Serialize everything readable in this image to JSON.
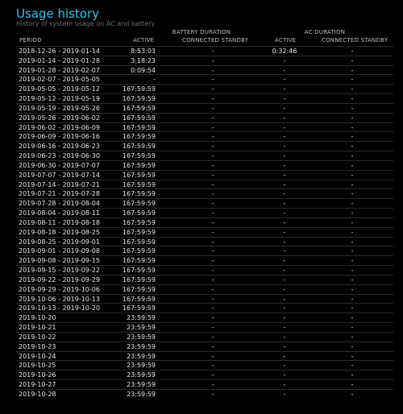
{
  "title": "Usage history",
  "subtitle": "History of system usage on AC and battery",
  "groups": {
    "battery": "BATTERY DURATION",
    "ac": "AC DURATION"
  },
  "columns": {
    "period": "PERIOD",
    "battery_active": "ACTIVE",
    "battery_standby": "CONNECTED STANDBY",
    "ac_active": "ACTIVE",
    "ac_standby": "CONNECTED STANDBY"
  },
  "rows": [
    {
      "period": "2018-12-26 - 2019-01-14",
      "battery_active": "8:53:03",
      "battery_standby": "-",
      "ac_active": "0:32:46",
      "ac_standby": "-"
    },
    {
      "period": "2019-01-14 - 2019-01-28",
      "battery_active": "3:18:23",
      "battery_standby": "-",
      "ac_active": "-",
      "ac_standby": "-"
    },
    {
      "period": "2019-01-28 - 2019-02-07",
      "battery_active": "0:09:54",
      "battery_standby": "-",
      "ac_active": "-",
      "ac_standby": "-"
    },
    {
      "period": "2019-02-07 - 2019-05-05",
      "battery_active": "-",
      "battery_standby": "-",
      "ac_active": "-",
      "ac_standby": "-"
    },
    {
      "period": "2019-05-05 - 2019-05-12",
      "battery_active": "167:59:59",
      "battery_standby": "-",
      "ac_active": "-",
      "ac_standby": "-"
    },
    {
      "period": "2019-05-12 - 2019-05-19",
      "battery_active": "167:59:59",
      "battery_standby": "-",
      "ac_active": "-",
      "ac_standby": "-"
    },
    {
      "period": "2019-05-19 - 2019-05-26",
      "battery_active": "167:59:59",
      "battery_standby": "-",
      "ac_active": "-",
      "ac_standby": "-"
    },
    {
      "period": "2019-05-26 - 2019-06-02",
      "battery_active": "167:59:59",
      "battery_standby": "-",
      "ac_active": "-",
      "ac_standby": "-"
    },
    {
      "period": "2019-06-02 - 2019-06-09",
      "battery_active": "167:59:59",
      "battery_standby": "-",
      "ac_active": "-",
      "ac_standby": "-"
    },
    {
      "period": "2019-06-09 - 2019-06-16",
      "battery_active": "167:59:59",
      "battery_standby": "-",
      "ac_active": "-",
      "ac_standby": "-"
    },
    {
      "period": "2019-06-16 - 2019-06-23",
      "battery_active": "167:59:59",
      "battery_standby": "-",
      "ac_active": "-",
      "ac_standby": "-"
    },
    {
      "period": "2019-06-23 - 2019-06-30",
      "battery_active": "167:59:59",
      "battery_standby": "-",
      "ac_active": "-",
      "ac_standby": "-"
    },
    {
      "period": "2019-06-30 - 2019-07-07",
      "battery_active": "167:59:59",
      "battery_standby": "-",
      "ac_active": "-",
      "ac_standby": "-"
    },
    {
      "period": "2019-07-07 - 2019-07-14",
      "battery_active": "167:59:59",
      "battery_standby": "-",
      "ac_active": "-",
      "ac_standby": "-"
    },
    {
      "period": "2019-07-14 - 2019-07-21",
      "battery_active": "167:59:59",
      "battery_standby": "-",
      "ac_active": "-",
      "ac_standby": "-"
    },
    {
      "period": "2019-07-21 - 2019-07-28",
      "battery_active": "167:59:59",
      "battery_standby": "-",
      "ac_active": "-",
      "ac_standby": "-"
    },
    {
      "period": "2019-07-28 - 2019-08-04",
      "battery_active": "167:59:59",
      "battery_standby": "-",
      "ac_active": "-",
      "ac_standby": "-"
    },
    {
      "period": "2019-08-04 - 2019-08-11",
      "battery_active": "167:59:59",
      "battery_standby": "-",
      "ac_active": "-",
      "ac_standby": "-"
    },
    {
      "period": "2019-08-11 - 2019-08-18",
      "battery_active": "167:59:59",
      "battery_standby": "-",
      "ac_active": "-",
      "ac_standby": "-"
    },
    {
      "period": "2019-08-18 - 2019-08-25",
      "battery_active": "167:59:59",
      "battery_standby": "-",
      "ac_active": "-",
      "ac_standby": "-"
    },
    {
      "period": "2019-08-25 - 2019-09-01",
      "battery_active": "167:59:59",
      "battery_standby": "-",
      "ac_active": "-",
      "ac_standby": "-"
    },
    {
      "period": "2019-09-01 - 2019-09-08",
      "battery_active": "167:59:59",
      "battery_standby": "-",
      "ac_active": "-",
      "ac_standby": "-"
    },
    {
      "period": "2019-09-08 - 2019-09-15",
      "battery_active": "167:59:59",
      "battery_standby": "-",
      "ac_active": "-",
      "ac_standby": "-"
    },
    {
      "period": "2019-09-15 - 2019-09-22",
      "battery_active": "167:59:59",
      "battery_standby": "-",
      "ac_active": "-",
      "ac_standby": "-"
    },
    {
      "period": "2019-09-22 - 2019-09-29",
      "battery_active": "167:59:59",
      "battery_standby": "-",
      "ac_active": "-",
      "ac_standby": "-"
    },
    {
      "period": "2019-09-29 - 2019-10-06",
      "battery_active": "167:59:59",
      "battery_standby": "-",
      "ac_active": "-",
      "ac_standby": "-"
    },
    {
      "period": "2019-10-06 - 2019-10-13",
      "battery_active": "167:59:59",
      "battery_standby": "-",
      "ac_active": "-",
      "ac_standby": "-"
    },
    {
      "period": "2019-10-13 - 2019-10-20",
      "battery_active": "167:59:59",
      "battery_standby": "-",
      "ac_active": "-",
      "ac_standby": "-"
    },
    {
      "period": "2019-10-20",
      "battery_active": "23:59:59",
      "battery_standby": "-",
      "ac_active": "-",
      "ac_standby": "-"
    },
    {
      "period": "2019-10-21",
      "battery_active": "23:59:59",
      "battery_standby": "-",
      "ac_active": "-",
      "ac_standby": "-"
    },
    {
      "period": "2019-10-22",
      "battery_active": "23:59:59",
      "battery_standby": "-",
      "ac_active": "-",
      "ac_standby": "-"
    },
    {
      "period": "2019-10-23",
      "battery_active": "23:59:59",
      "battery_standby": "-",
      "ac_active": "-",
      "ac_standby": "-"
    },
    {
      "period": "2019-10-24",
      "battery_active": "23:59:59",
      "battery_standby": "-",
      "ac_active": "-",
      "ac_standby": "-"
    },
    {
      "period": "2019-10-25",
      "battery_active": "23:59:59",
      "battery_standby": "-",
      "ac_active": "-",
      "ac_standby": "-"
    },
    {
      "period": "2019-10-26",
      "battery_active": "23:59:59",
      "battery_standby": "-",
      "ac_active": "-",
      "ac_standby": "-"
    },
    {
      "period": "2019-10-27",
      "battery_active": "23:59:59",
      "battery_standby": "-",
      "ac_active": "-",
      "ac_standby": "-"
    },
    {
      "period": "2019-10-28",
      "battery_active": "23:59:59",
      "battery_standby": "-",
      "ac_active": "-",
      "ac_standby": "-"
    }
  ],
  "colors": {
    "background": "#000000",
    "title": "#35c2e8",
    "subtitle": "#6f6f6f",
    "text": "#e8e8e8",
    "header": "#bdbdbd",
    "divider": "#2a2a2a"
  }
}
